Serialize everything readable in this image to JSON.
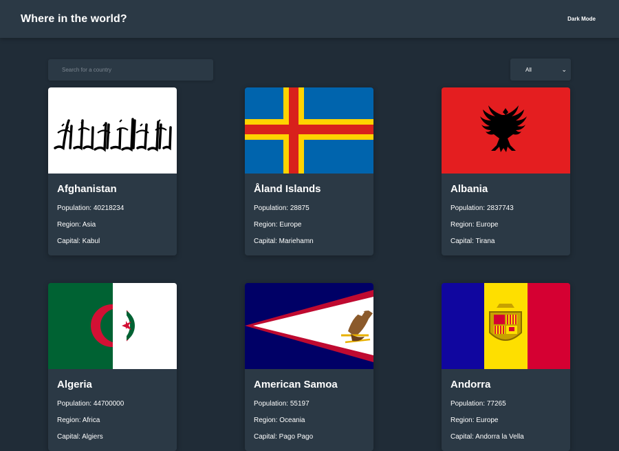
{
  "header": {
    "title": "Where in the world?",
    "mode_toggle": "Dark Mode"
  },
  "search": {
    "placeholder": "Search for a country"
  },
  "filter": {
    "selected": "All"
  },
  "countries": [
    {
      "name": "Afghanistan",
      "population": "Population: 40218234",
      "region": "Region: Asia",
      "capital": "Capital: Kabul",
      "flag_icon": "afghanistan-flag"
    },
    {
      "name": "Åland Islands",
      "population": "Population: 28875",
      "region": "Region: Europe",
      "capital": "Capital: Mariehamn",
      "flag_icon": "aland-flag"
    },
    {
      "name": "Albania",
      "population": "Population: 2837743",
      "region": "Region: Europe",
      "capital": "Capital: Tirana",
      "flag_icon": "albania-flag"
    },
    {
      "name": "Algeria",
      "population": "Population: 44700000",
      "region": "Region: Africa",
      "capital": "Capital: Algiers",
      "flag_icon": "algeria-flag"
    },
    {
      "name": "American Samoa",
      "population": "Population: 55197",
      "region": "Region: Oceania",
      "capital": "Capital: Pago Pago",
      "flag_icon": "american-samoa-flag"
    },
    {
      "name": "Andorra",
      "population": "Population: 77265",
      "region": "Region: Europe",
      "capital": "Capital: Andorra la Vella",
      "flag_icon": "andorra-flag"
    }
  ],
  "colors": {
    "background": "#202c37",
    "element": "#2b3945",
    "text": "#ffffff"
  }
}
